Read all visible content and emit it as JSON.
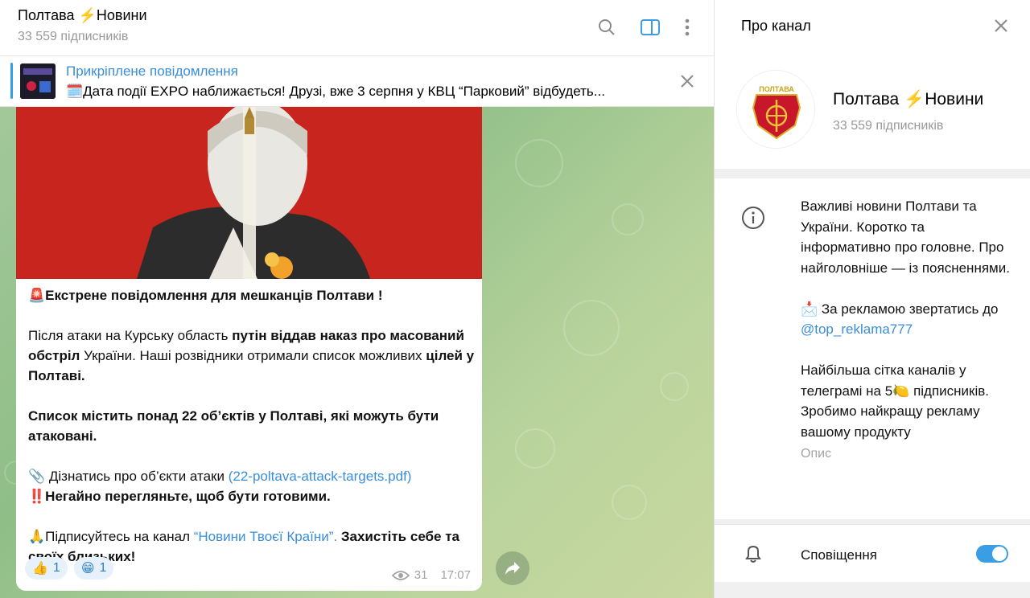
{
  "chat": {
    "title": "Полтава ⚡️Новини",
    "subscribers": "33 559 підписників"
  },
  "pinned": {
    "label": "Прикріплене повідомлення",
    "text": "🗓️Дата події EXPO наближається!  Друзі, вже 3 серпня у КВЦ “Парковий” відбудеть..."
  },
  "message": {
    "headline_emoji": "🚨",
    "headline": "Екстрене повідомлення для мешканців Полтави !",
    "p1_a": "Після атаки на Курську область ",
    "p1_b": "путін віддав наказ про масований обстріл",
    "p1_c": " України. Наші розвідники отримали список можливих ",
    "p1_d": "цілей у Полтаві.",
    "p2": "Список містить понад 22 об’єктів у Полтаві, які можуть бути атаковані.",
    "p3_emoji": "📎",
    "p3_text": " Дізнатись про об’єкти атаки ",
    "p3_link": "(22-poltava-attack-targets.pdf)",
    "p4_emoji": "‼️",
    "p4_text": "Негайно перегляньте, щоб бути готовими.",
    "p5_emoji": "🙏",
    "p5_text": "Підписуйтесь на канал ",
    "p5_link": "“Новини Твоєї Країни”.",
    "p5_bold": " Захистіть себе та своїх близьких!",
    "reactions": [
      {
        "emoji": "👍",
        "count": "1"
      },
      {
        "emoji": "😁",
        "count": "1"
      }
    ],
    "views": "31",
    "time": "17:07"
  },
  "panel": {
    "title": "Про канал",
    "name": "Полтава ⚡️Новини",
    "subscribers": "33 559 підписників",
    "desc_1": "Важливі новини Полтави та України. Коротко та інформативно про головне. Про найголовніше — із поясненнями.",
    "desc_2a": "📩 За рекламою звертатись до ",
    "desc_2b": "@top_reklama777",
    "desc_3": "Найбільша сітка каналів у телеграмі на 5🍋 підписників. Зробимо найкращу рекламу вашому продукту",
    "desc_label": "Опис",
    "notif_label": "Сповіщення",
    "notif_on": true
  },
  "colors": {
    "accent": "#3a9ee4",
    "link": "#3a8ed9",
    "media_red": "#c8251f"
  }
}
